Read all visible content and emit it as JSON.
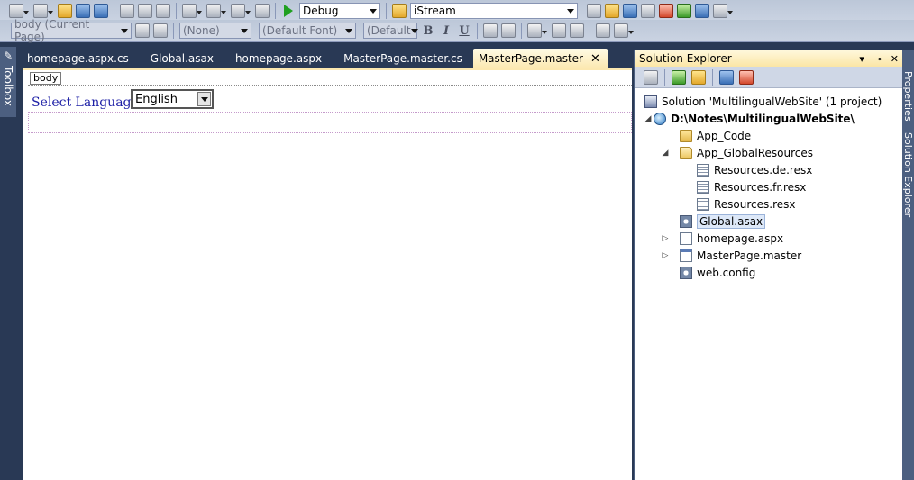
{
  "toolbar": {
    "config_combo": "Debug",
    "startup_combo": "iStream"
  },
  "format_toolbar": {
    "block_combo": "body (Current Page)",
    "style_combo": "(None)",
    "font_combo": "(Default Font)",
    "size_combo": "(Default",
    "bold": "B",
    "italic": "I",
    "underline": "U"
  },
  "toolbox": {
    "label": "Toolbox"
  },
  "tabs": [
    {
      "label": "homepage.aspx.cs",
      "active": false
    },
    {
      "label": "Global.asax",
      "active": false
    },
    {
      "label": "homepage.aspx",
      "active": false
    },
    {
      "label": "MasterPage.master.cs",
      "active": false
    },
    {
      "label": "MasterPage.master",
      "active": true
    }
  ],
  "tab_close": "✕",
  "designer": {
    "tag_navigator": "body",
    "select_label": "Select Language :",
    "select_value": "English"
  },
  "solution_explorer": {
    "title": "Solution Explorer",
    "controls": [
      "▾",
      "⊸",
      "✕"
    ],
    "items": [
      {
        "label": "Solution 'MultilingualWebSite' (1 project)",
        "icon": "solution-icon"
      },
      {
        "label": "D:\\Notes\\MultilingualWebSite\\",
        "icon": "website-icon",
        "bold": true,
        "expander": "◢"
      },
      {
        "label": "App_Code",
        "icon": "folder-icon"
      },
      {
        "label": "App_GlobalResources",
        "icon": "folder-open-icon",
        "expander": "◢"
      },
      {
        "label": "Resources.de.resx",
        "icon": "resx-file-icon"
      },
      {
        "label": "Resources.fr.resx",
        "icon": "resx-file-icon"
      },
      {
        "label": "Resources.resx",
        "icon": "resx-file-icon"
      },
      {
        "label": "Global.asax",
        "icon": "asax-file-icon",
        "selected": true
      },
      {
        "label": "homepage.aspx",
        "icon": "aspx-file-icon",
        "expander": "▷"
      },
      {
        "label": "MasterPage.master",
        "icon": "master-file-icon",
        "expander": "▷"
      },
      {
        "label": "web.config",
        "icon": "config-file-icon"
      }
    ]
  },
  "right_strip": {
    "properties": "Properties",
    "solution_explorer": "Solution Explorer"
  },
  "colors": {
    "ide_background": "#293955",
    "active_tab": "#fce8b0",
    "label_text": "#1d1fa6"
  }
}
